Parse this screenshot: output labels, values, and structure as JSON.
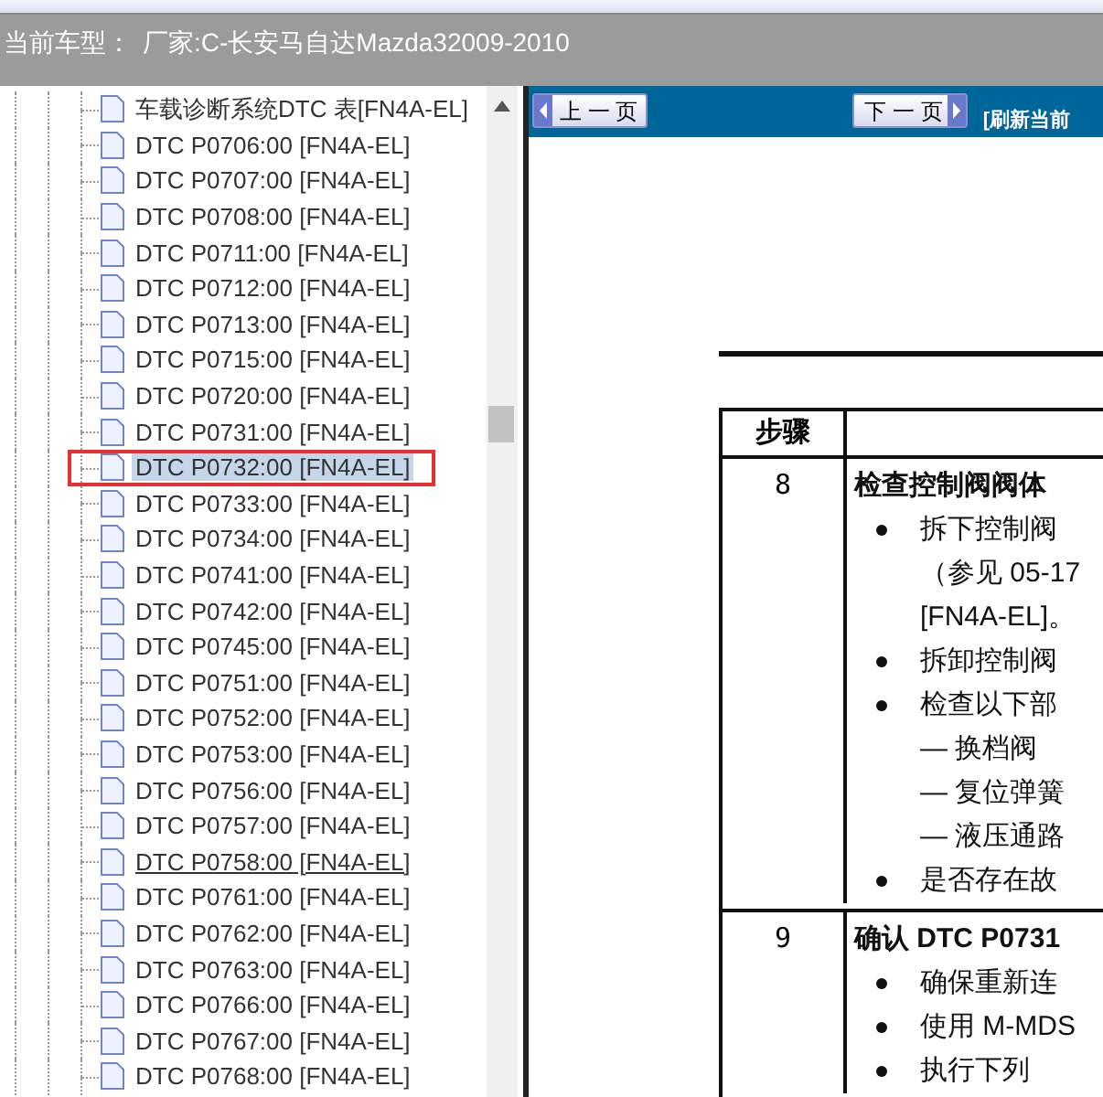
{
  "info_bar": {
    "label": "当前车型：",
    "value": "厂家:C-长安马自达Mazda32009-2010"
  },
  "tree": {
    "items": [
      {
        "label": "车载诊断系统DTC 表[FN4A-EL]",
        "selected": false,
        "hovered": false,
        "marked": false
      },
      {
        "label": "DTC P0706:00 [FN4A-EL]",
        "selected": false,
        "hovered": false,
        "marked": false
      },
      {
        "label": "DTC P0707:00 [FN4A-EL]",
        "selected": false,
        "hovered": false,
        "marked": false
      },
      {
        "label": "DTC P0708:00 [FN4A-EL]",
        "selected": false,
        "hovered": false,
        "marked": false
      },
      {
        "label": "DTC P0711:00 [FN4A-EL]",
        "selected": false,
        "hovered": false,
        "marked": false
      },
      {
        "label": "DTC P0712:00 [FN4A-EL]",
        "selected": false,
        "hovered": false,
        "marked": false
      },
      {
        "label": "DTC P0713:00 [FN4A-EL]",
        "selected": false,
        "hovered": false,
        "marked": false
      },
      {
        "label": "DTC P0715:00 [FN4A-EL]",
        "selected": false,
        "hovered": false,
        "marked": false
      },
      {
        "label": "DTC P0720:00 [FN4A-EL]",
        "selected": false,
        "hovered": false,
        "marked": false
      },
      {
        "label": "DTC P0731:00 [FN4A-EL]",
        "selected": false,
        "hovered": false,
        "marked": false
      },
      {
        "label": "DTC P0732:00 [FN4A-EL]",
        "selected": true,
        "hovered": false,
        "marked": true
      },
      {
        "label": "DTC P0733:00 [FN4A-EL]",
        "selected": false,
        "hovered": false,
        "marked": false
      },
      {
        "label": "DTC P0734:00 [FN4A-EL]",
        "selected": false,
        "hovered": false,
        "marked": false
      },
      {
        "label": "DTC P0741:00 [FN4A-EL]",
        "selected": false,
        "hovered": false,
        "marked": false
      },
      {
        "label": "DTC P0742:00 [FN4A-EL]",
        "selected": false,
        "hovered": false,
        "marked": false
      },
      {
        "label": "DTC P0745:00 [FN4A-EL]",
        "selected": false,
        "hovered": false,
        "marked": false
      },
      {
        "label": "DTC P0751:00 [FN4A-EL]",
        "selected": false,
        "hovered": false,
        "marked": false
      },
      {
        "label": "DTC P0752:00 [FN4A-EL]",
        "selected": false,
        "hovered": false,
        "marked": false
      },
      {
        "label": "DTC P0753:00 [FN4A-EL]",
        "selected": false,
        "hovered": false,
        "marked": false
      },
      {
        "label": "DTC P0756:00 [FN4A-EL]",
        "selected": false,
        "hovered": false,
        "marked": false
      },
      {
        "label": "DTC P0757:00 [FN4A-EL]",
        "selected": false,
        "hovered": false,
        "marked": false
      },
      {
        "label": "DTC P0758:00 [FN4A-EL]",
        "selected": false,
        "hovered": true,
        "marked": false
      },
      {
        "label": "DTC P0761:00 [FN4A-EL]",
        "selected": false,
        "hovered": false,
        "marked": false
      },
      {
        "label": "DTC P0762:00 [FN4A-EL]",
        "selected": false,
        "hovered": false,
        "marked": false
      },
      {
        "label": "DTC P0763:00 [FN4A-EL]",
        "selected": false,
        "hovered": false,
        "marked": false
      },
      {
        "label": "DTC P0766:00 [FN4A-EL]",
        "selected": false,
        "hovered": false,
        "marked": false
      },
      {
        "label": "DTC P0767:00 [FN4A-EL]",
        "selected": false,
        "hovered": false,
        "marked": false
      },
      {
        "label": "DTC P0768:00 [FN4A-EL]",
        "selected": false,
        "hovered": false,
        "marked": false
      }
    ]
  },
  "viewer_toolbar": {
    "prev_button": "上 一 页",
    "next_button": "下 一 页",
    "refresh_link": "[刷新当前"
  },
  "document": {
    "table": {
      "header": "步骤",
      "rows": [
        {
          "step": "8",
          "lines": [
            {
              "kind": "heading",
              "text": "检查控制阀阀体"
            },
            {
              "kind": "bullet",
              "text": "拆下控制阀"
            },
            {
              "kind": "cont",
              "text": "（参见 05-17"
            },
            {
              "kind": "cont",
              "text": "[FN4A-EL]。"
            },
            {
              "kind": "bullet",
              "text": "拆卸控制阀"
            },
            {
              "kind": "bullet",
              "text": "检查以下部"
            },
            {
              "kind": "dash",
              "text": "— 换档阀"
            },
            {
              "kind": "dash",
              "text": "— 复位弹簧"
            },
            {
              "kind": "dash",
              "text": "— 液压通路"
            },
            {
              "kind": "bullet",
              "text": "是否存在故"
            }
          ]
        },
        {
          "step": "9",
          "lines": [
            {
              "kind": "heading",
              "text": "确认 DTC P0731"
            },
            {
              "kind": "bullet",
              "text": "确保重新连"
            },
            {
              "kind": "bullet",
              "text": "使用 M-MDS"
            },
            {
              "kind": "bullet",
              "text": "执行下列"
            }
          ]
        }
      ]
    }
  }
}
